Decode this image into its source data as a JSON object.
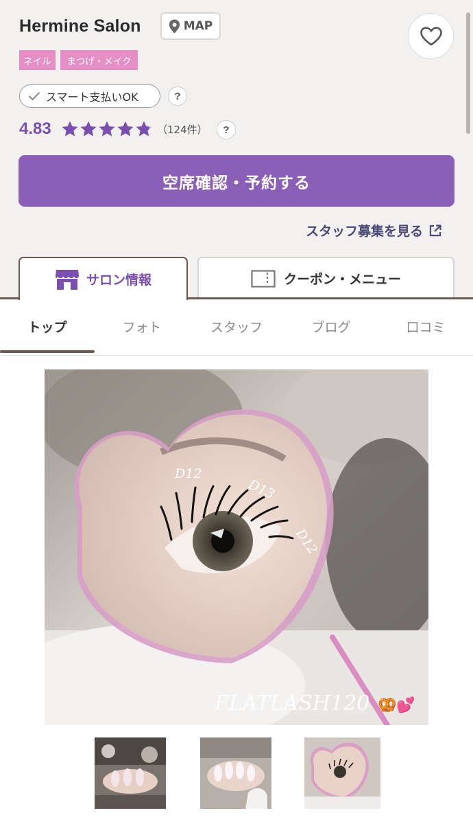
{
  "salon": {
    "name": "Hermine Salon",
    "map_label": "MAP",
    "tags": [
      "ネイル",
      "まつげ・メイク"
    ],
    "smart_pay": "スマート支払いOK",
    "help_mark": "?",
    "rating": "4.83",
    "rating_value": 4.83,
    "stars_max": 5,
    "review_count": "（124件）"
  },
  "actions": {
    "reserve": "空席確認・予約する",
    "staff_recruit": "スタッフ募集を見る"
  },
  "tabs": {
    "salon_info": "サロン情報",
    "coupon_menu": "クーポン・メニュー"
  },
  "subnav": [
    "トップ",
    "フォト",
    "スタッフ",
    "ブログ",
    "口コミ"
  ],
  "photo": {
    "labels": [
      "D12",
      "D13",
      "D12"
    ],
    "caption": "FLATLASH120",
    "emoji": "🥨💕"
  },
  "colors": {
    "accent": "#8a5fb8",
    "tag_pink": "#e58fc6",
    "link": "#4b4877",
    "tab_border": "#6e5a52"
  },
  "icons": {
    "map": "map-pin-icon",
    "favorite": "heart-icon",
    "check": "check-icon",
    "external": "external-link-icon",
    "salon": "storefront-icon",
    "coupon": "ticket-icon"
  }
}
